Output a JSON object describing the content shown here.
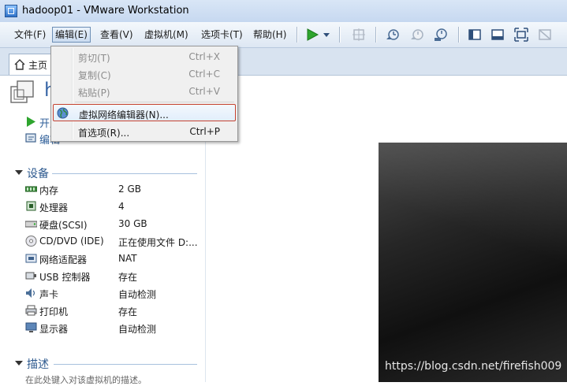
{
  "window": {
    "title": "hadoop01 - VMware Workstation"
  },
  "menubar": {
    "items": [
      "文件(F)",
      "编辑(E)",
      "查看(V)",
      "虚拟机(M)",
      "选项卡(T)",
      "帮助(H)"
    ]
  },
  "tabs": {
    "home_label": "主页"
  },
  "vm": {
    "name_partial": "h",
    "actions": [
      "开启",
      "编辑"
    ]
  },
  "devices": {
    "heading": "设备",
    "rows": [
      {
        "icon": "memory-icon",
        "name": "内存",
        "value": "2 GB"
      },
      {
        "icon": "processor-icon",
        "name": "处理器",
        "value": "4"
      },
      {
        "icon": "hard-disk-icon",
        "name": "硬盘(SCSI)",
        "value": "30 GB"
      },
      {
        "icon": "cd-dvd-icon",
        "name": "CD/DVD (IDE)",
        "value": "正在使用文件 D:..."
      },
      {
        "icon": "network-adapter-icon",
        "name": "网络适配器",
        "value": "NAT"
      },
      {
        "icon": "usb-icon",
        "name": "USB 控制器",
        "value": "存在"
      },
      {
        "icon": "sound-icon",
        "name": "声卡",
        "value": "自动检测"
      },
      {
        "icon": "printer-icon",
        "name": "打印机",
        "value": "存在"
      },
      {
        "icon": "display-icon",
        "name": "显示器",
        "value": "自动检测"
      }
    ]
  },
  "description": {
    "heading": "描述",
    "hint": "在此处键入对该虚拟机的描述。"
  },
  "edit_menu": {
    "items": [
      {
        "label": "剪切(T)",
        "shortcut": "Ctrl+X",
        "enabled": false
      },
      {
        "label": "复制(C)",
        "shortcut": "Ctrl+C",
        "enabled": false
      },
      {
        "label": "粘贴(P)",
        "shortcut": "Ctrl+V",
        "enabled": false
      },
      {
        "label": "虚拟网络编辑器(N)...",
        "shortcut": "",
        "enabled": true,
        "highlighted": true
      },
      {
        "label": "首选项(R)...",
        "shortcut": "Ctrl+P",
        "enabled": true
      }
    ]
  },
  "watermark": "https://blog.csdn.net/firefish009",
  "colors": {
    "accent_blue": "#2e5a8f",
    "highlight_border": "#c6422f",
    "play_green": "#2ea52e"
  }
}
